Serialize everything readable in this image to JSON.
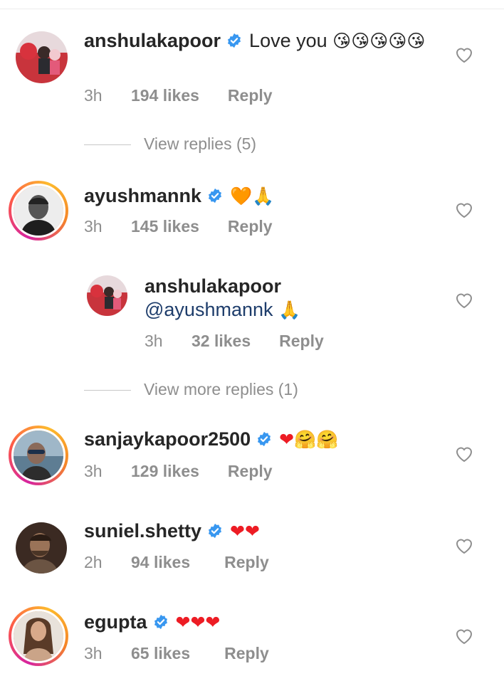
{
  "colors": {
    "verified": "#3897f0",
    "meta": "#8e8e8e",
    "mention": "#1e3d6b",
    "red_heart": "#ed1c24",
    "orange_heart": "#f7931e"
  },
  "comments": [
    {
      "username": "anshulakapoor",
      "verified": true,
      "text": "Love you",
      "emojis": "😘😘😘😘😘",
      "time": "3h",
      "likes": "194 likes",
      "reply": "Reply",
      "view_replies": "View replies (5)"
    },
    {
      "username": "ayushmannk",
      "verified": true,
      "emojis": "🧡🙏",
      "time": "3h",
      "likes": "145 likes",
      "reply": "Reply",
      "view_replies": "View more replies (1)",
      "reply_item": {
        "username": "anshulakapoor",
        "mention": "@ayushmannk",
        "emojis": "🙏",
        "time": "3h",
        "likes": "32 likes",
        "reply": "Reply"
      }
    },
    {
      "username": "sanjaykapoor2500",
      "verified": true,
      "emojis": "❤🤗🤗",
      "time": "3h",
      "likes": "129 likes",
      "reply": "Reply"
    },
    {
      "username": "suniel.shetty",
      "verified": true,
      "emojis": "❤❤",
      "time": "2h",
      "likes": "94 likes",
      "reply": "Reply"
    },
    {
      "username": "egupta",
      "verified": true,
      "emojis": "❤❤❤",
      "time": "3h",
      "likes": "65 likes",
      "reply": "Reply"
    }
  ]
}
